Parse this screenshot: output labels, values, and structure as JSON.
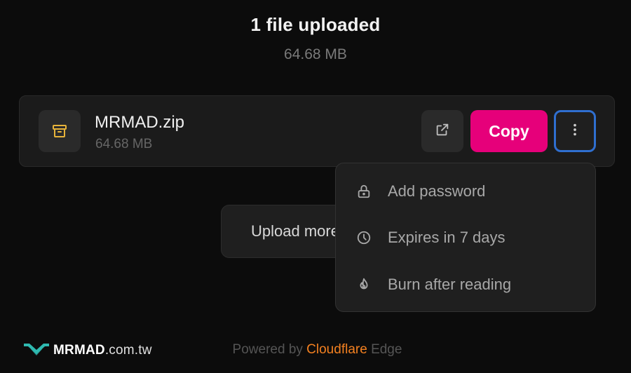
{
  "header": {
    "title": "1 file uploaded",
    "total_size": "64.68 MB"
  },
  "file": {
    "icon": "archive-icon",
    "name": "MRMAD.zip",
    "size": "64.68 MB"
  },
  "actions": {
    "open_icon": "external-link-icon",
    "copy_label": "Copy",
    "more_icon": "more-vertical-icon"
  },
  "upload_more_label": "Upload more",
  "menu": {
    "items": [
      {
        "icon": "lock-icon",
        "label": "Add password"
      },
      {
        "icon": "clock-icon",
        "label": "Expires in 7 days"
      },
      {
        "icon": "flame-icon",
        "label": "Burn after reading"
      }
    ]
  },
  "footer": {
    "prefix": "Powered by",
    "brand": "Cloudflare",
    "suffix": "Edge"
  },
  "watermark": {
    "brand": "MRMAD",
    "domain": ".com.tw"
  },
  "colors": {
    "accent": "#e6007a",
    "focus_ring": "#2f6fd0",
    "cloudflare": "#f38020",
    "archive_icon": "#e7b33a",
    "logo_teal": "#2fb9b0"
  }
}
